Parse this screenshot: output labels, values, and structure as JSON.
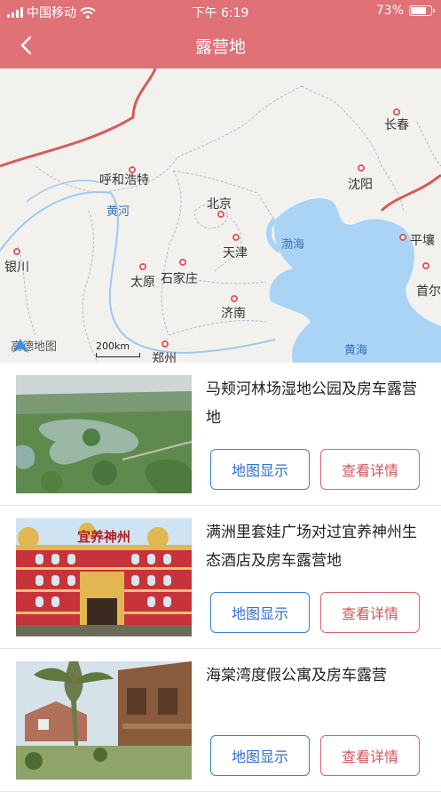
{
  "status_bar": {
    "carrier": "中国移动",
    "time": "下午 6:19",
    "battery": "73%",
    "battery_level": 0.73
  },
  "nav": {
    "back_icon": "chevron-left-icon",
    "title": "露营地"
  },
  "map": {
    "cities": [
      "长春",
      "呼和浩特",
      "沈阳",
      "北京",
      "天津",
      "平壤",
      "银川",
      "太原",
      "石家庄",
      "首尔",
      "济南",
      "郑州"
    ],
    "waters": [
      "黄河",
      "渤海",
      "黄海"
    ],
    "provider": "高德地图",
    "scale": "200km"
  },
  "campsites": [
    {
      "name": "马颊河林场湿地公园及房车露营地",
      "map_label": "地图显示",
      "detail_label": "查看详情"
    },
    {
      "name": "满洲里套娃广场对过宜养神州生态酒店及房车露营地",
      "map_label": "地图显示",
      "detail_label": "查看详情",
      "photo_sign": "宜养神州"
    },
    {
      "name": "海棠湾度假公寓及房车露营",
      "map_label": "地图显示",
      "detail_label": "查看详情"
    }
  ],
  "colors": {
    "header": "#e07177",
    "map_button": "#3b7fd9",
    "detail_button": "#d8666a",
    "sea": "#a9d4f5"
  }
}
